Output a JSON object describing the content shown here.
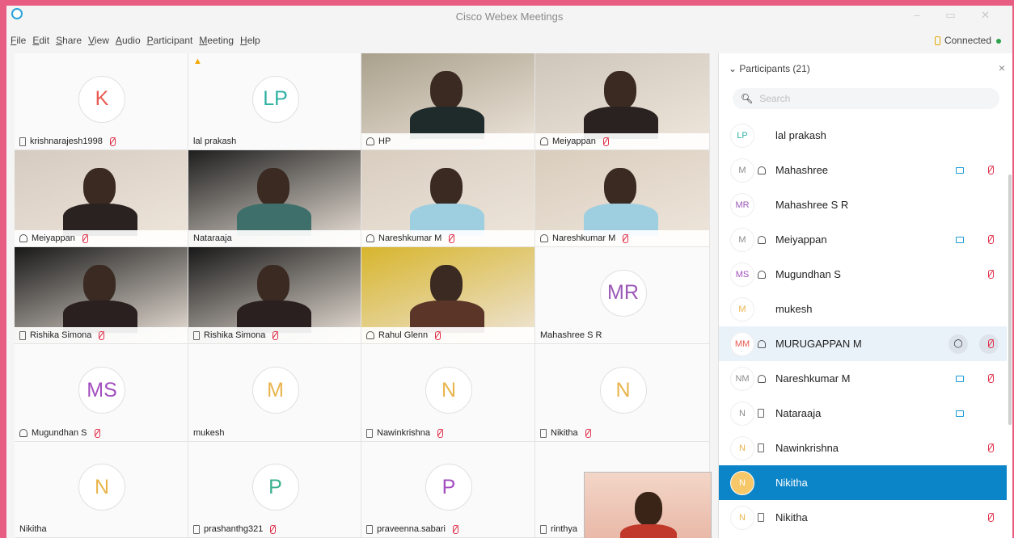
{
  "window": {
    "title": "Cisco Webex Meetings",
    "controls": "– ▭ ✕"
  },
  "menu": [
    "File",
    "Edit",
    "Share",
    "View",
    "Audio",
    "Participant",
    "Meeting",
    "Help"
  ],
  "menu_accel": [
    "F",
    "E",
    "S",
    "V",
    "A",
    "P",
    "M",
    "H"
  ],
  "status": {
    "connection": "Connected"
  },
  "colors": {
    "accent": "#0b84c8",
    "mute": "#e0304a",
    "frame": "#e85d82"
  },
  "tiles": [
    {
      "label": "krishnarajesh1998",
      "initials": "K",
      "color": "#e85a4f",
      "icon": "phone",
      "muted": true,
      "video": false
    },
    {
      "label": "lal prakash",
      "initials": "LP",
      "color": "#2fb1a3",
      "icon": "",
      "muted": false,
      "video": false,
      "warn": "▲"
    },
    {
      "label": "HP",
      "icon": "headset",
      "muted": false,
      "video": true,
      "bg": "#a9a08c",
      "body": "#1f2a2a"
    },
    {
      "label": "Meiyappan",
      "icon": "headset",
      "muted": true,
      "video": true,
      "bg": "#cfc6bb",
      "body": "#2a2220"
    },
    {
      "label": "Meiyappan",
      "icon": "headset",
      "muted": true,
      "video": true,
      "bg": "#d6cbc1",
      "body": "#2a2220"
    },
    {
      "label": "Nataraaja",
      "icon": "",
      "muted": false,
      "video": true,
      "bg": "#1e1e1e",
      "body": "#3f6f6a"
    },
    {
      "label": "Nareshkumar M",
      "icon": "headset",
      "muted": true,
      "video": true,
      "bg": "#d8cdbf",
      "body": "#9ecfe0"
    },
    {
      "label": "Nareshkumar M",
      "icon": "headset",
      "muted": true,
      "video": true,
      "bg": "#d9cdbd",
      "body": "#9ecfe0"
    },
    {
      "label": "Rishika Simona",
      "icon": "phone",
      "muted": true,
      "video": true,
      "bg": "#181818",
      "body": "#2a2020"
    },
    {
      "label": "Rishika Simona",
      "icon": "phone",
      "muted": true,
      "video": true,
      "bg": "#181818",
      "body": "#2a2020"
    },
    {
      "label": "Rahul Glenn",
      "icon": "headset",
      "muted": true,
      "video": true,
      "bg": "#d7b52d",
      "body": "#5a3528"
    },
    {
      "label": "Mahashree S R",
      "initials": "MR",
      "color": "#9b59b6",
      "icon": "",
      "muted": false,
      "video": false
    },
    {
      "label": "Mugundhan S",
      "initials": "MS",
      "color": "#a34fc0",
      "icon": "headset",
      "muted": true,
      "video": false
    },
    {
      "label": "mukesh",
      "initials": "M",
      "color": "#e9b44c",
      "icon": "",
      "muted": false,
      "video": false
    },
    {
      "label": "Nawinkrishna",
      "initials": "N",
      "color": "#e9b44c",
      "icon": "phone",
      "muted": true,
      "video": false
    },
    {
      "label": "Nikitha",
      "initials": "N",
      "color": "#e9b44c",
      "icon": "phone",
      "muted": true,
      "video": false
    },
    {
      "label": "Nikitha",
      "initials": "N",
      "color": "#e9b44c",
      "icon": "",
      "muted": false,
      "video": false
    },
    {
      "label": "prashanthg321",
      "initials": "P",
      "color": "#3bb08f",
      "icon": "phone",
      "muted": true,
      "video": false
    },
    {
      "label": "praveenna.sabari",
      "initials": "P",
      "color": "#a34fc0",
      "icon": "phone",
      "muted": true,
      "video": false
    },
    {
      "label": "rinthya",
      "initials": "",
      "color": "#999",
      "icon": "phone",
      "muted": false,
      "video": false
    }
  ],
  "panel": {
    "title": "Participants (21)",
    "close": "×",
    "search_placeholder": "Search",
    "participants": [
      {
        "initials": "LP",
        "name": "lal prakash",
        "icon": "",
        "camera": false,
        "muted": false,
        "initials_color": "#2fb1a3"
      },
      {
        "initials": "M",
        "name": "Mahashree",
        "icon": "headset",
        "camera": true,
        "muted": true,
        "initials_color": "#8a8a8a"
      },
      {
        "initials": "MR",
        "name": "Mahashree S R",
        "icon": "",
        "camera": false,
        "muted": false,
        "initials_color": "#9b59b6"
      },
      {
        "initials": "M",
        "name": "Meiyappan",
        "icon": "headset",
        "camera": true,
        "muted": true,
        "initials_color": "#8a8a8a"
      },
      {
        "initials": "MS",
        "name": "Mugundhan S",
        "icon": "headset",
        "camera": false,
        "muted": true,
        "initials_color": "#a34fc0"
      },
      {
        "initials": "M",
        "name": "mukesh",
        "icon": "",
        "camera": false,
        "muted": false,
        "initials_color": "#e9b44c"
      },
      {
        "initials": "MM",
        "name": "MURUGAPPAN M",
        "icon": "headset",
        "camera": false,
        "muted": true,
        "initials_color": "#e85a4f",
        "hover": true
      },
      {
        "initials": "NM",
        "name": "Nareshkumar M",
        "icon": "headset",
        "camera": true,
        "muted": true,
        "initials_color": "#8a8a8a"
      },
      {
        "initials": "N",
        "name": "Nataraaja",
        "icon": "phone",
        "camera": true,
        "muted": false,
        "initials_color": "#8a8a8a"
      },
      {
        "initials": "N",
        "name": "Nawinkrishna",
        "icon": "phone",
        "camera": false,
        "muted": true,
        "initials_color": "#e9b44c"
      },
      {
        "initials": "N",
        "name": "Nikitha",
        "icon": "",
        "camera": false,
        "muted": false,
        "initials_color": "#ffffff",
        "selected": true
      },
      {
        "initials": "N",
        "name": "Nikitha",
        "icon": "phone",
        "camera": false,
        "muted": true,
        "initials_color": "#e9b44c"
      }
    ]
  }
}
